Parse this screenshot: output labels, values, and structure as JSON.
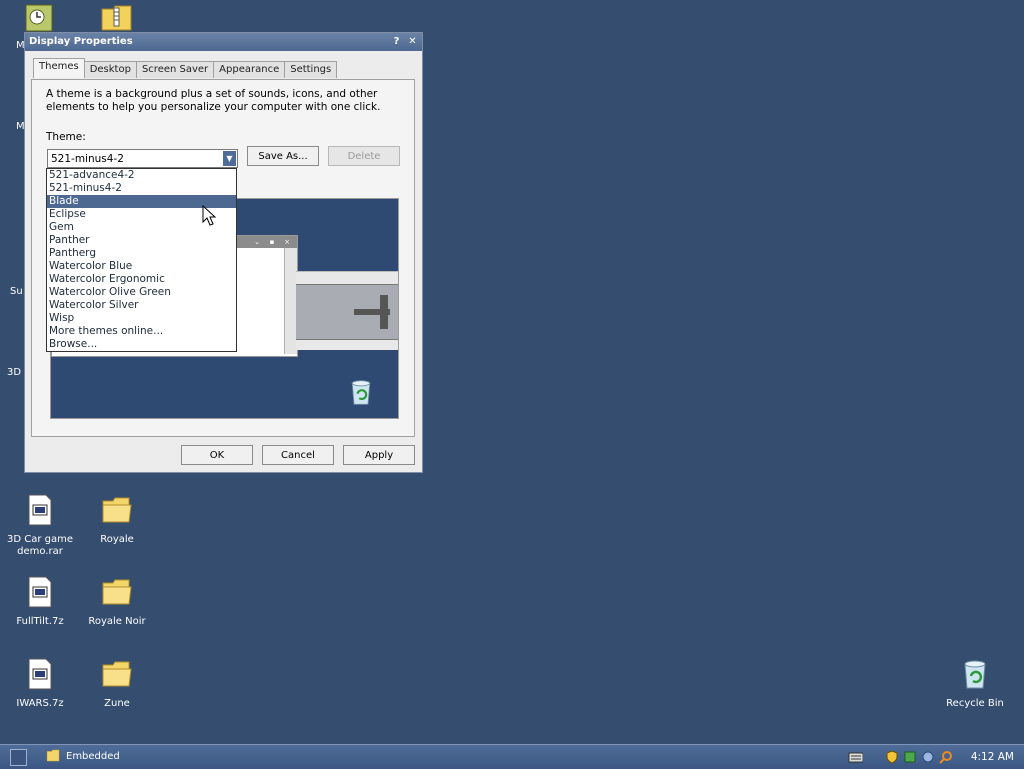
{
  "window": {
    "title": "Display Properties",
    "tabs": [
      "Themes",
      "Desktop",
      "Screen Saver",
      "Appearance",
      "Settings"
    ],
    "description": "A theme is a background plus a set of sounds, icons, and other elements to help you personalize your computer with one click.",
    "theme_label": "Theme:",
    "theme_value": "521-minus4-2",
    "save_as_label": "Save As...",
    "delete_label": "Delete",
    "ok_label": "OK",
    "cancel_label": "Cancel",
    "apply_label": "Apply",
    "dropdown_items": [
      "521-advance4-2",
      "521-minus4-2",
      "Blade",
      "Eclipse",
      "Gem",
      "Panther",
      "Pantherg",
      "Watercolor Blue",
      "Watercolor Ergonomic",
      "Watercolor Olive Green",
      "Watercolor Silver",
      "Wisp",
      "More themes online...",
      "Browse..."
    ],
    "selected_index": 2
  },
  "desktop": {
    "icons": {
      "car_game": "3D Car game demo.rar",
      "royale": "Royale",
      "fulltilt": "FullTilt.7z",
      "royale_noir": "Royale Noir",
      "iwars": "IWARS.7z",
      "zune": "Zune",
      "recycle_bin": "Recycle Bin"
    },
    "partial_labels": [
      "M",
      "M",
      "Su",
      "3D"
    ]
  },
  "taskbar": {
    "task_label": "Embedded",
    "clock": "4:12 AM"
  },
  "colors": {
    "desktop": "#354d6f",
    "selection": "#4d6891",
    "taskbar": "#3b5682"
  }
}
